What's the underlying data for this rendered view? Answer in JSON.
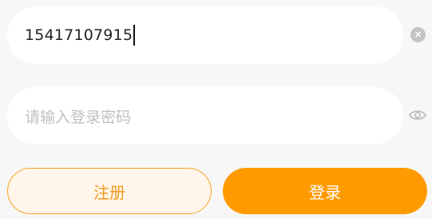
{
  "form": {
    "phone_value": "15417107915",
    "password_placeholder": "请输入登录密码"
  },
  "icons": {
    "clear": "clear-circle-x-icon",
    "password_visibility": "eye-icon"
  },
  "buttons": {
    "register_label": "注册",
    "login_label": "登录"
  },
  "colors": {
    "accent": "#ff9b00",
    "accent_light_bg": "#fff5ea",
    "page_bg": "#f7f7f7"
  }
}
